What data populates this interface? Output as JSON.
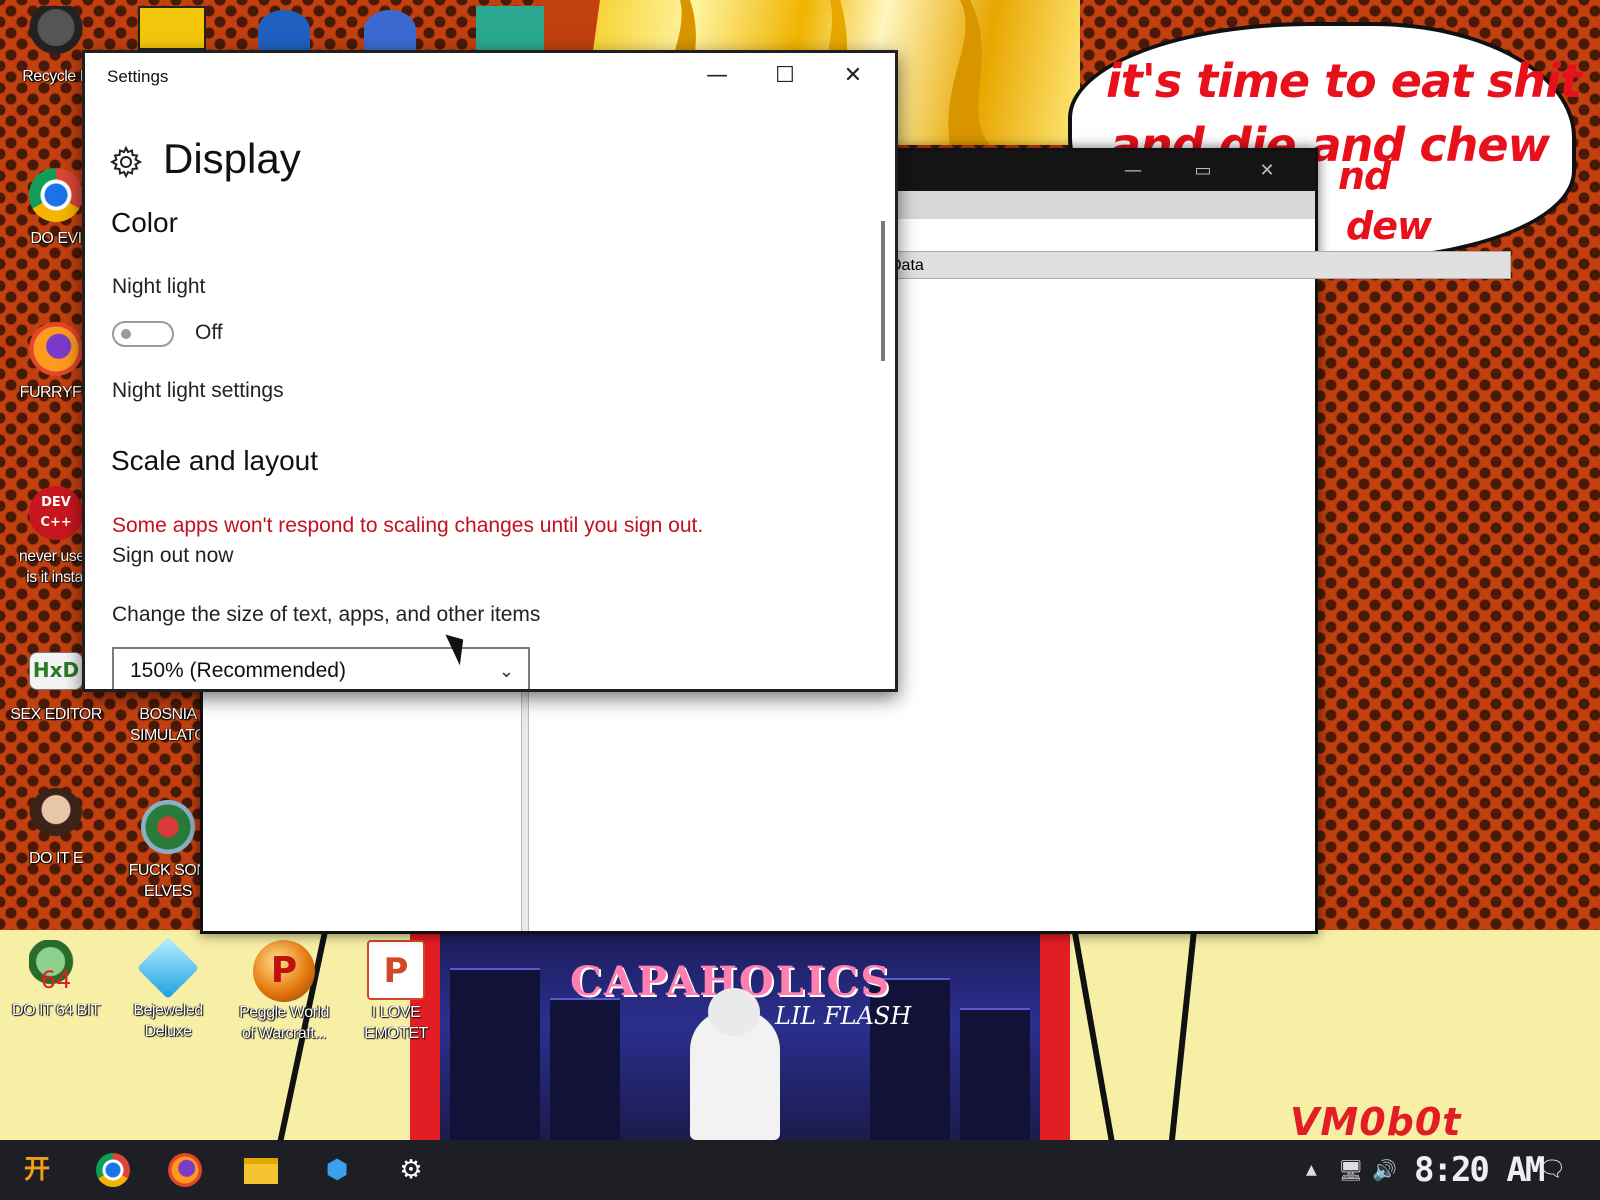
{
  "wallpaper": {
    "bubble_lines": [
      "it's time to eat shit",
      "and die and chew",
      "nd",
      "dew"
    ],
    "album_title": "CAPAHOLICS",
    "album_artist": "LIL FLASH",
    "watermark": "VM0b0t",
    "colors": {
      "background": "#c2400f",
      "bubble_text": "#e8101a",
      "album_panel": "#e31d24"
    }
  },
  "desktop_icons": [
    {
      "label": "Recycle B",
      "icon": "recycle-bin-icon"
    },
    {
      "label": "DO EVI",
      "icon": "chrome-icon"
    },
    {
      "label": "FURRYFU",
      "icon": "firefox-icon"
    },
    {
      "label": "never used\nis it instal",
      "icon": "dev-cpp-icon",
      "glyph_text": "DEV C++"
    },
    {
      "label": "SEX EDITOR",
      "icon": "hex-editor-icon",
      "glyph_text": "HxD"
    },
    {
      "label": "BOSNIA\nSIMULATO",
      "icon": "game-icon"
    },
    {
      "label": "DO IT  E",
      "icon": "portrait-icon"
    },
    {
      "label": "FUCK SON\nELVES",
      "icon": "elf-game-icon"
    },
    {
      "label": "DO IT 64 BIT",
      "icon": "character-icon",
      "glyph_text": "64"
    },
    {
      "label": "Bejeweled\nDeluxe",
      "icon": "bejeweled-gem-icon"
    },
    {
      "label": "Peggle World\nof Warcraft...",
      "icon": "peggle-icon",
      "glyph_text": "P"
    },
    {
      "label": "I LOVE\nEMOTET",
      "icon": "powerpoint-icon",
      "glyph_text": "P"
    }
  ],
  "background_window": {
    "column_header": "Data",
    "controls": {
      "minimize": "—",
      "maximize": "▭",
      "close": "✕"
    }
  },
  "settings": {
    "window_title": "Settings",
    "controls": {
      "minimize": "—",
      "maximize": "☐",
      "close": "✕"
    },
    "page_title": "Display",
    "color_section": "Color",
    "night_light_label": "Night light",
    "night_light_state": "Off",
    "night_light_settings_link": "Night light settings",
    "scale_section": "Scale and layout",
    "scale_warning": "Some apps won't respond to scaling changes until you sign out.",
    "sign_out_link": "Sign out now",
    "size_label": "Change the size of text, apps, and other items",
    "size_value": "150% (Recommended)"
  },
  "taskbar": {
    "items": [
      "start-icon",
      "chrome-icon",
      "firefox-icon",
      "file-explorer-icon",
      "app-icon",
      "settings-gear-icon"
    ],
    "clock": "8:20 AM"
  }
}
